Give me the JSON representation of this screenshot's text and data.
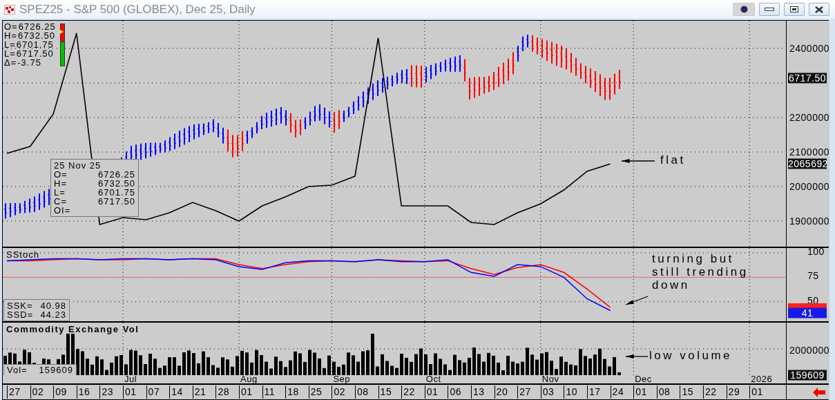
{
  "window": {
    "title": "SPEZ25 - S&P 500 (GLOBEX), Dec 25, Daily"
  },
  "legend": [
    {
      "label": "O=",
      "value": "6726.25"
    },
    {
      "label": "H=",
      "value": "6732.50"
    },
    {
      "label": "L=",
      "value": "6701.75"
    },
    {
      "label": "L=",
      "value": "6717.50"
    },
    {
      "label": "Δ=",
      "value": "-3.75"
    }
  ],
  "data_window": {
    "date": "25 Nov 25",
    "rows": [
      {
        "label": "O=",
        "value": "6726.25"
      },
      {
        "label": "H=",
        "value": "6732.50"
      },
      {
        "label": "L=",
        "value": "6701.75"
      },
      {
        "label": "C=",
        "value": "6717.50"
      },
      {
        "label": "OI="
      }
    ]
  },
  "price_panel": {
    "price_badge": "6717.50",
    "line_badge": "2065692",
    "annotation": "flat",
    "axis_labels": [
      "2400000",
      "2200000",
      "2100000",
      "2000000",
      "1900000"
    ]
  },
  "stoch_panel": {
    "title": "SStoch",
    "annotation": "turning but\nstill trending\ndown",
    "axis_labels": [
      "100",
      "75",
      "50"
    ],
    "readouts": [
      {
        "label": "SSK=",
        "value": "40.98"
      },
      {
        "label": "SSD=",
        "value": "44.23"
      }
    ],
    "badges": [
      {
        "color": "#ff2020"
      },
      {
        "color": "#1a1ae6",
        "text": "41"
      }
    ]
  },
  "volume_panel": {
    "title": "Commodity Exchange Vol",
    "readout": {
      "label": "Vol=",
      "value": "159609"
    },
    "axis_label": "2000000",
    "badge": "159609",
    "annotation": "low volume"
  },
  "x_axis": [
    {
      "label": "27"
    },
    {
      "label": "02"
    },
    {
      "label": "09"
    },
    {
      "label": "16"
    },
    {
      "label": "23"
    },
    {
      "label": "01",
      "month": "Jul"
    },
    {
      "label": "07"
    },
    {
      "label": "14"
    },
    {
      "label": "21"
    },
    {
      "label": "28"
    },
    {
      "label": "01",
      "month": "Aug"
    },
    {
      "label": "11"
    },
    {
      "label": "18"
    },
    {
      "label": "25"
    },
    {
      "label": "02",
      "month": "Sep"
    },
    {
      "label": "08"
    },
    {
      "label": "15"
    },
    {
      "label": "22"
    },
    {
      "label": "01",
      "month": "Oct"
    },
    {
      "label": "06"
    },
    {
      "label": "13"
    },
    {
      "label": "20"
    },
    {
      "label": "27"
    },
    {
      "label": "03",
      "month": "Nov"
    },
    {
      "label": "10"
    },
    {
      "label": "17"
    },
    {
      "label": "24"
    },
    {
      "label": "01",
      "month": "Dec"
    },
    {
      "label": "08"
    },
    {
      "label": "15"
    },
    {
      "label": "22"
    },
    {
      "label": "29"
    },
    {
      "label": "01",
      "month": "2026"
    }
  ]
}
